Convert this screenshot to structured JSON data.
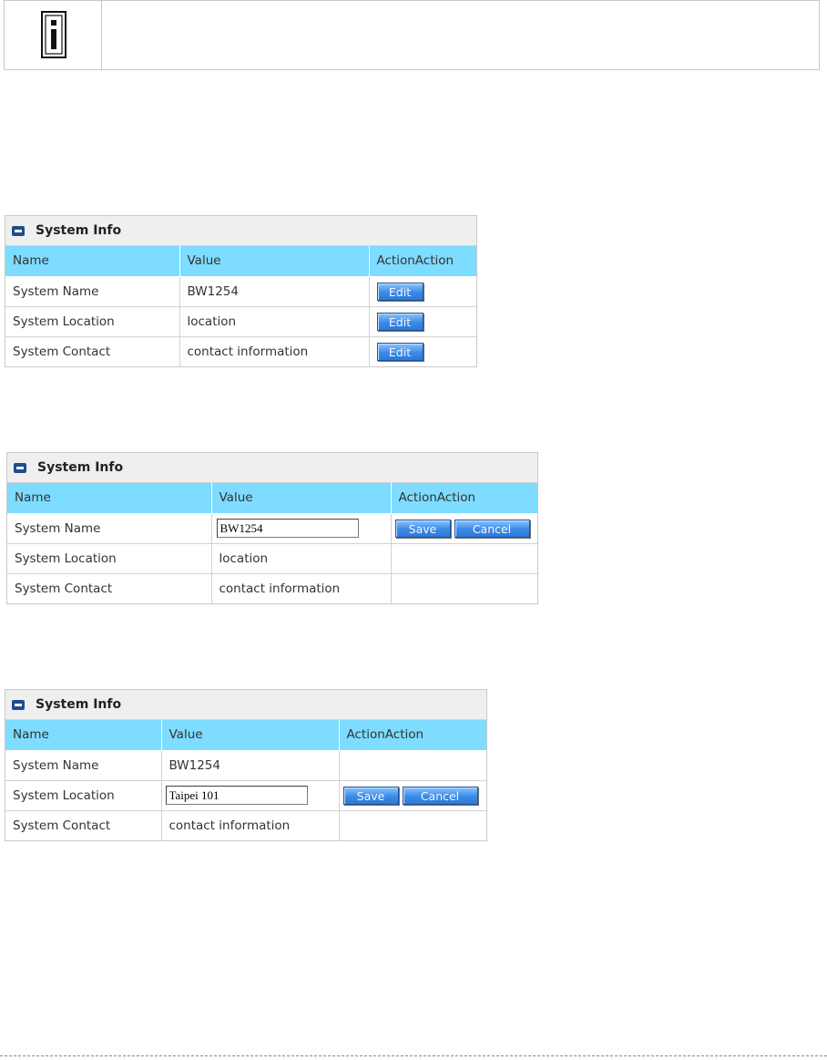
{
  "note": {
    "icon": "info-icon",
    "text": ""
  },
  "panels": [
    {
      "title": "System Info",
      "columns": [
        "Name",
        "Value",
        "ActionAction"
      ],
      "rows": [
        {
          "name": "System Name",
          "value": "BW1254",
          "action": "Edit"
        },
        {
          "name": "System Location",
          "value": "location",
          "action": "Edit"
        },
        {
          "name": "System Contact",
          "value": "contact information",
          "action": "Edit"
        }
      ]
    },
    {
      "title": "System Info",
      "columns": [
        "Name",
        "Value",
        "ActionAction"
      ],
      "rows": [
        {
          "name": "System Name",
          "input_value": "BW1254",
          "save": "Save",
          "cancel": "Cancel"
        },
        {
          "name": "System Location",
          "value": "location"
        },
        {
          "name": "System Contact",
          "value": "contact information"
        }
      ]
    },
    {
      "title": "System Info",
      "columns": [
        "Name",
        "Value",
        "ActionAction"
      ],
      "rows": [
        {
          "name": "System Name",
          "value": "BW1254"
        },
        {
          "name": "System Location",
          "input_value": "Taipei 101",
          "save": "Save",
          "cancel": "Cancel"
        },
        {
          "name": "System Contact",
          "value": "contact information"
        }
      ]
    }
  ],
  "colors": {
    "header_bg": "#7ddcff",
    "title_bg": "#efefef",
    "button_blue": "#3b8ae8",
    "title_icon": "#1d4d8b"
  }
}
